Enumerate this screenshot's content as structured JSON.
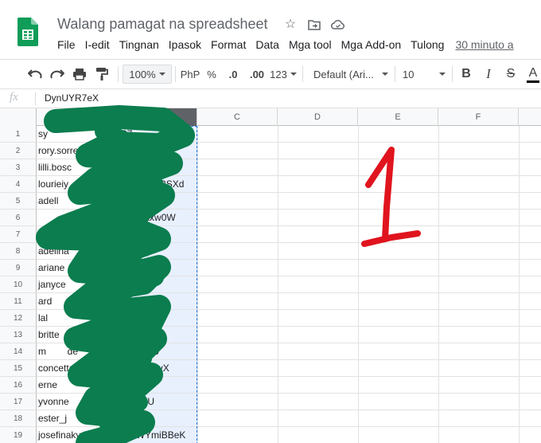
{
  "app": {
    "title": "Walang pamagat na spreadsheet",
    "last_edit": "30 minuto a",
    "icons": [
      "sheets-logo-icon",
      "star-icon",
      "move-folder-icon",
      "cloud-status-icon"
    ]
  },
  "menu": [
    "File",
    "I-edit",
    "Tingnan",
    "Ipasok",
    "Format",
    "Data",
    "Mga tool",
    "Mga Add-on",
    "Tulong"
  ],
  "toolbar": {
    "zoom": "100%",
    "currency": "PhP",
    "percent": "%",
    "decrease_decimals": ".0",
    "increase_decimals": ".00",
    "number_format": "123",
    "font": "Default (Ari...",
    "font_size": "10",
    "bold": "B",
    "italic": "I",
    "strikethrough": "S",
    "text_color": "A"
  },
  "formula_bar": {
    "fx": "fx",
    "value": "DynUYR7eX"
  },
  "grid": {
    "columns": [
      "A",
      "B",
      "C",
      "D",
      "E",
      "F"
    ],
    "selected_column": "B",
    "rows": [
      "1",
      "2",
      "3",
      "4",
      "5",
      "6",
      "7",
      "8",
      "9",
      "10",
      "11",
      "12",
      "13",
      "14",
      "15",
      "16",
      "17",
      "18",
      "19"
    ],
    "cells": [
      "sy                         YR7",
      "rory.sorre",
      "lilli.bosc                          CHz3",
      "lourieiy                          s8M23SXd",
      "adell                           gTjM",
      "                                 DnSaxw0W",
      "              le.t                5qbuo1j",
      "adelina                         fYqi",
      "ariane                          KZy",
      "janyce",
      "ard                                Q",
      "lal                                 W",
      "britte                             vkz",
      "m        de                      7U59",
      "concetta                      uKr55vX",
      "erne                              OT",
      "yvonne                         R1U",
      "ester_j                        V17L",
      "josefinakv                VBWYmiBBeK"
    ]
  },
  "annotation": {
    "handwritten_number": "1",
    "colors": {
      "scribble": "#0b7d4e",
      "ink": "#e0141e"
    }
  },
  "colors": {
    "sheets_green": "#0f9d58",
    "selection_fill": "#e8f0fe",
    "selection_border": "#1a73e8"
  }
}
